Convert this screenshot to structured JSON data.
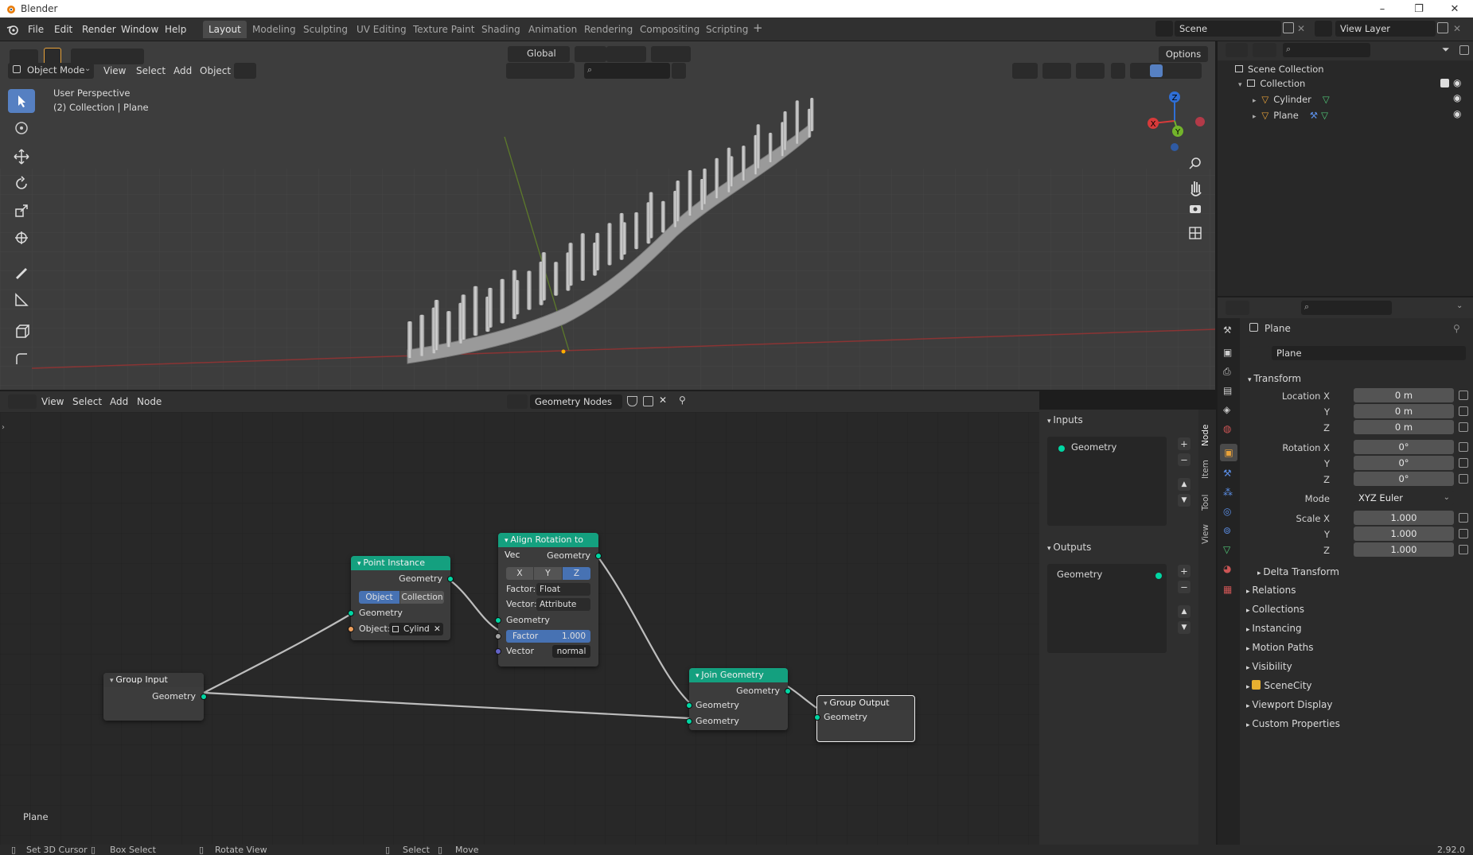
{
  "window": {
    "title": "Blender"
  },
  "menubar": {
    "items": [
      "File",
      "Edit",
      "Render",
      "Window",
      "Help"
    ],
    "workspaces": [
      "Layout",
      "Modeling",
      "Sculpting",
      "UV Editing",
      "Texture Paint",
      "Shading",
      "Animation",
      "Rendering",
      "Compositing",
      "Scripting"
    ],
    "active_workspace": "Layout",
    "scene": "Scene",
    "view_layer": "View Layer"
  },
  "viewport": {
    "mode": "Object Mode",
    "menus": [
      "View",
      "Select",
      "Add",
      "Object"
    ],
    "transform_orientation": "Global",
    "options_label": "Options",
    "overlay_line1": "User Perspective",
    "overlay_line2": "(2) Collection | Plane",
    "gizmo": {
      "x": "X",
      "y": "Y",
      "z": "Z"
    }
  },
  "node_editor": {
    "menus": [
      "View",
      "Select",
      "Add",
      "Node"
    ],
    "tree_name": "Geometry Nodes",
    "footer_label": "Plane",
    "nodes": {
      "group_input": {
        "title": "Group Input",
        "out": "Geometry"
      },
      "point_instance": {
        "title": "Point Instance",
        "out": "Geometry",
        "mode_object": "Object",
        "mode_collection": "Collection",
        "in_geometry": "Geometry",
        "object_label": "Object:",
        "object_value": "Cylind"
      },
      "align_rotation": {
        "title": "Align Rotation to Vec",
        "out": "Geometry",
        "axis": [
          "X",
          "Y",
          "Z"
        ],
        "active_axis": "Z",
        "factor_label": "Factor:",
        "factor_mode": "Float",
        "vector_label": "Vector:",
        "vector_mode": "Attribute",
        "in_geometry": "Geometry",
        "factor_field": "Factor",
        "factor_value": "1.000",
        "in_vector": "Vector",
        "vector_value": "normal"
      },
      "join_geometry": {
        "title": "Join Geometry",
        "out": "Geometry",
        "in1": "Geometry",
        "in2": "Geometry"
      },
      "group_output": {
        "title": "Group Output",
        "in": "Geometry"
      }
    }
  },
  "side_panel": {
    "inputs_header": "Inputs",
    "input_item": "Geometry",
    "outputs_header": "Outputs",
    "output_item": "Geometry",
    "tabs": [
      "Node",
      "Item",
      "Tool",
      "View"
    ]
  },
  "outliner": {
    "root": "Scene Collection",
    "collection": "Collection",
    "objects": [
      "Cylinder",
      "Plane"
    ]
  },
  "properties": {
    "object_name": "Plane",
    "object_field": "Plane",
    "transform_header": "Transform",
    "location": {
      "label": "Location X",
      "x": "0 m",
      "y": "0 m",
      "z": "0 m"
    },
    "rotation": {
      "label": "Rotation X",
      "x": "0°",
      "y": "0°",
      "z": "0°"
    },
    "mode_label": "Mode",
    "mode_value": "XYZ Euler",
    "scale": {
      "label": "Scale X",
      "x": "1.000",
      "y": "1.000",
      "z": "1.000"
    },
    "axis_y": "Y",
    "axis_z": "Z",
    "delta_transform": "Delta Transform",
    "sections": [
      "Relations",
      "Collections",
      "Instancing",
      "Motion Paths",
      "Visibility",
      "SceneCity",
      "Viewport Display",
      "Custom Properties"
    ]
  },
  "statusbar": {
    "items": [
      "Set 3D Cursor",
      "Box Select",
      "Rotate View",
      "Select",
      "Move"
    ],
    "version": "2.92.0"
  },
  "colors": {
    "accent": "#5680c2",
    "node_header_green": "#14a07f",
    "node_header_dark": "#3a3a3a",
    "socket_geometry": "#00d6a3",
    "socket_object": "#ed9e5c",
    "socket_vector": "#6363c7"
  }
}
